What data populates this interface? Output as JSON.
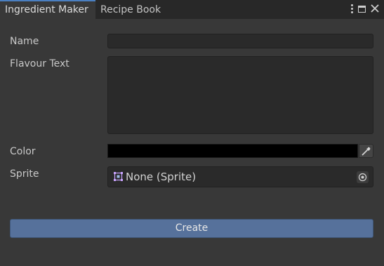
{
  "tabs": [
    {
      "label": "Ingredient Maker",
      "active": true
    },
    {
      "label": "Recipe Book",
      "active": false
    }
  ],
  "window_icons": [
    "kebab-menu-icon",
    "maximize-icon",
    "close-icon"
  ],
  "form": {
    "name_label": "Name",
    "name_value": "",
    "flavour_label": "Flavour Text",
    "flavour_value": "",
    "color_label": "Color",
    "color_value": "#000000",
    "sprite_label": "Sprite",
    "sprite_value": "None (Sprite)"
  },
  "create_label": "Create",
  "colors": {
    "accent": "#4a7fc1",
    "button": "#56719b",
    "background": "#383838",
    "field": "#2a2a2a"
  }
}
